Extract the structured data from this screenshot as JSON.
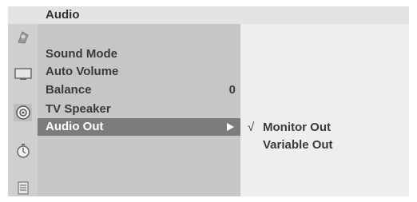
{
  "header": {
    "title": "Audio"
  },
  "sidebar": {
    "icons": [
      {
        "name": "picture-icon"
      },
      {
        "name": "screen-icon"
      },
      {
        "name": "audio-speaker-icon",
        "selected": true
      },
      {
        "name": "timer-clock-icon"
      },
      {
        "name": "option-settings-icon"
      }
    ]
  },
  "menu": {
    "items": [
      {
        "label": "Sound Mode",
        "value": ""
      },
      {
        "label": "Auto Volume",
        "value": ""
      },
      {
        "label": "Balance",
        "value": "0"
      },
      {
        "label": "TV Speaker",
        "value": ""
      },
      {
        "label": "Audio Out",
        "value": "",
        "selected": true
      }
    ]
  },
  "submenu": {
    "check_mark": "√",
    "items": [
      {
        "label": "Monitor Out",
        "checked": true
      },
      {
        "label": "Variable Out",
        "checked": false
      }
    ]
  },
  "colors": {
    "highlight": "#7c7c7c",
    "menu_panel": "#c6c6c6",
    "icon_column": "#cfcfcf",
    "background": "#eeeeee"
  }
}
